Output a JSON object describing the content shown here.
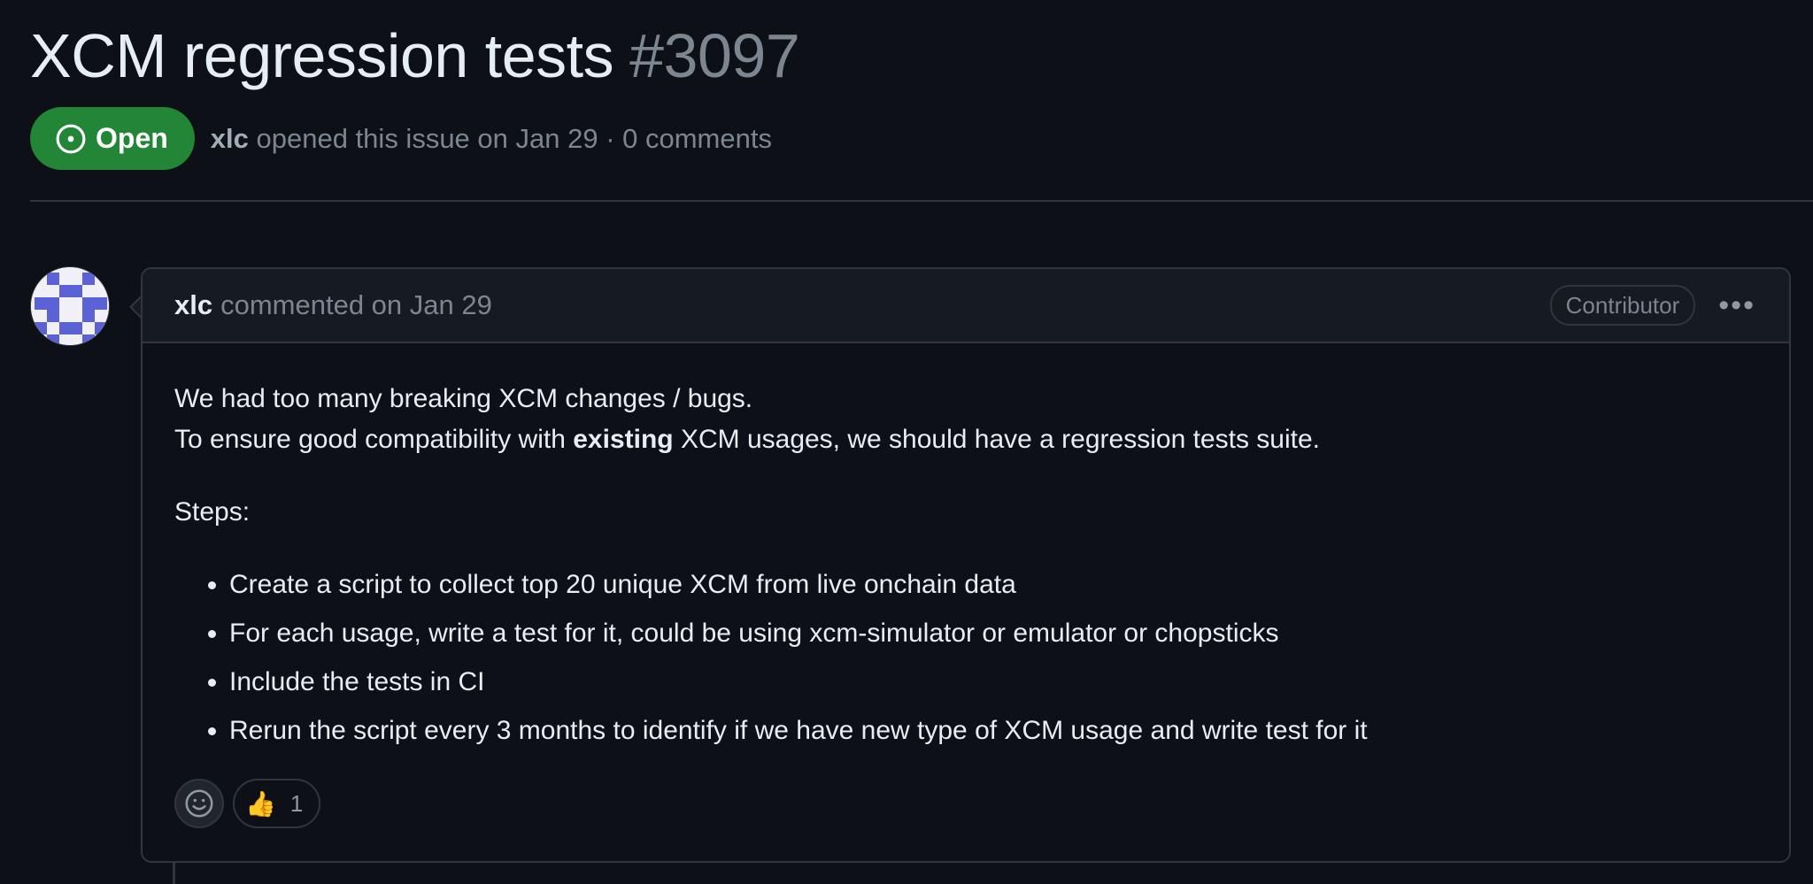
{
  "issue": {
    "title": "XCM regression tests",
    "number": "#3097",
    "state": "Open",
    "author": "xlc",
    "opened_text": "opened this issue on Jan 29 · 0 comments"
  },
  "comment": {
    "author": "xlc",
    "action": "commented on Jan 29",
    "role": "Contributor",
    "menu_icon": "kebab-horizontal-icon",
    "body": {
      "line1": "We had too many breaking XCM changes / bugs.",
      "line2_prefix": "To ensure good compatibility with ",
      "line2_bold": "existing",
      "line2_suffix": " XCM usages, we should have a regression tests suite.",
      "steps_label": "Steps:",
      "steps": [
        "Create a script to collect top 20 unique XCM from live onchain data",
        "For each usage, write a test for it, could be using xcm-simulator or emulator or chopsticks",
        "Include the tests in CI",
        "Rerun the script every 3 months to identify if we have new type of XCM usage and write test for it"
      ]
    },
    "reactions": [
      {
        "emoji": "👍",
        "count": "1"
      }
    ]
  },
  "colors": {
    "background": "#0d1117",
    "open_badge": "#238636",
    "border": "#30363d",
    "muted_text": "#7d8590",
    "avatar_identicon": "#5b62d5"
  }
}
